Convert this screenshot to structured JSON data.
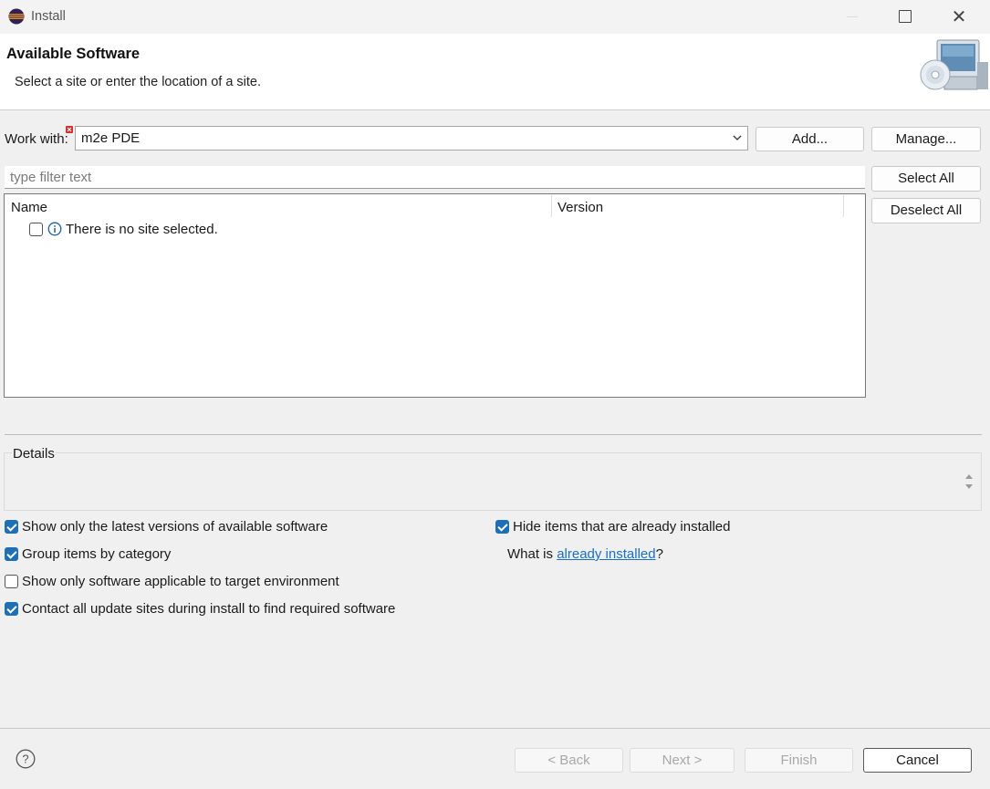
{
  "window": {
    "title": "Install"
  },
  "banner": {
    "title": "Available Software",
    "subtitle": "Select a site or enter the location of a site."
  },
  "work_with": {
    "label": "Work with:",
    "value": "m2e PDE",
    "add_label": "Add...",
    "manage_label": "Manage..."
  },
  "filter": {
    "placeholder": "type filter text"
  },
  "selection_buttons": {
    "select_all": "Select All",
    "deselect_all": "Deselect All"
  },
  "table": {
    "columns": [
      "Name",
      "Version"
    ],
    "rows": [
      {
        "checked": false,
        "icon": "info-icon",
        "text": "There is no site selected."
      }
    ]
  },
  "details": {
    "label": "Details"
  },
  "options": {
    "left": [
      {
        "label": "Show only the latest versions of available software",
        "checked": true
      },
      {
        "label": "Group items by category",
        "checked": true
      },
      {
        "label": "Show only software applicable to target environment",
        "checked": false
      },
      {
        "label": "Contact all update sites during install to find required software",
        "checked": true
      }
    ],
    "right": [
      {
        "label": "Hide items that are already installed",
        "checked": true
      }
    ],
    "what_is": {
      "prefix": "What is ",
      "link": "already installed",
      "suffix": "?"
    }
  },
  "footer": {
    "back": "< Back",
    "next": "Next >",
    "finish": "Finish",
    "cancel": "Cancel"
  },
  "colors": {
    "accent": "#1f6fb5",
    "link": "#1a6fc4",
    "error": "#d32f2f"
  }
}
